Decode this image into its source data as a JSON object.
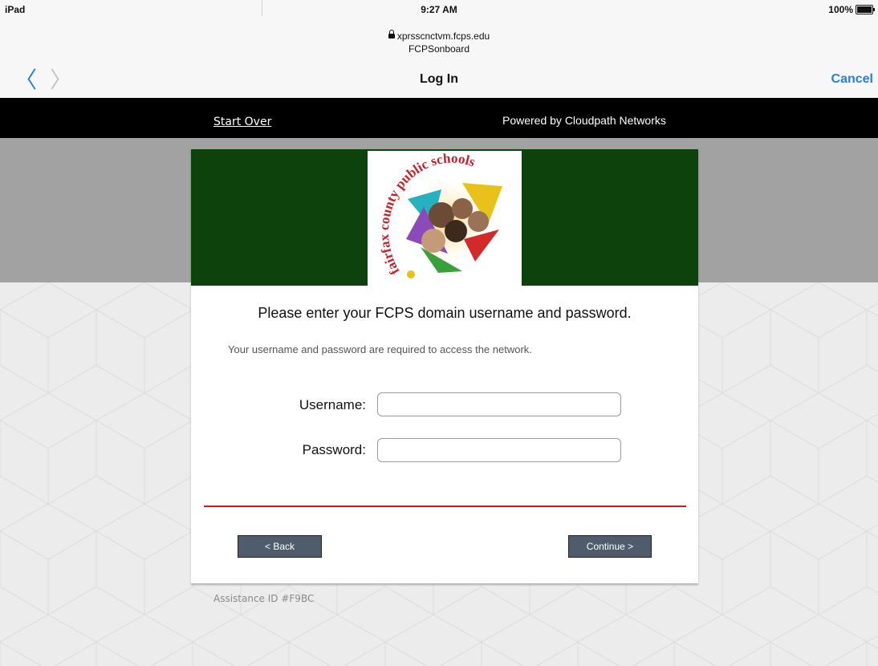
{
  "status_bar": {
    "device": "iPad",
    "time": "9:27 AM",
    "battery": "100%"
  },
  "url_bar": {
    "host": "xprsscnctvm.fcps.edu",
    "subtitle": "FCPSonboard"
  },
  "nav": {
    "title": "Log In",
    "back_glyph": "〈",
    "forward_glyph": "〉",
    "cancel_label": "Cancel"
  },
  "header": {
    "start_over": "Start Over",
    "powered_by": "Powered by Cloudpath Networks"
  },
  "logo": {
    "arc_text": "fairfax county public schools"
  },
  "form": {
    "heading": "Please enter your FCPS domain username and password.",
    "subtext": "Your username and password are required to access the network.",
    "username_label": "Username:",
    "username_value": "",
    "password_label": "Password:",
    "password_value": ""
  },
  "buttons": {
    "back": "< Back",
    "continue": "Continue >"
  },
  "footer": {
    "assistance_id": "Assistance ID #F9BC"
  },
  "colors": {
    "banner_green": "#0d420d",
    "link_blue": "#2a7de1",
    "divider_red": "#d11a1a",
    "button_slate": "#4f5c6c"
  }
}
